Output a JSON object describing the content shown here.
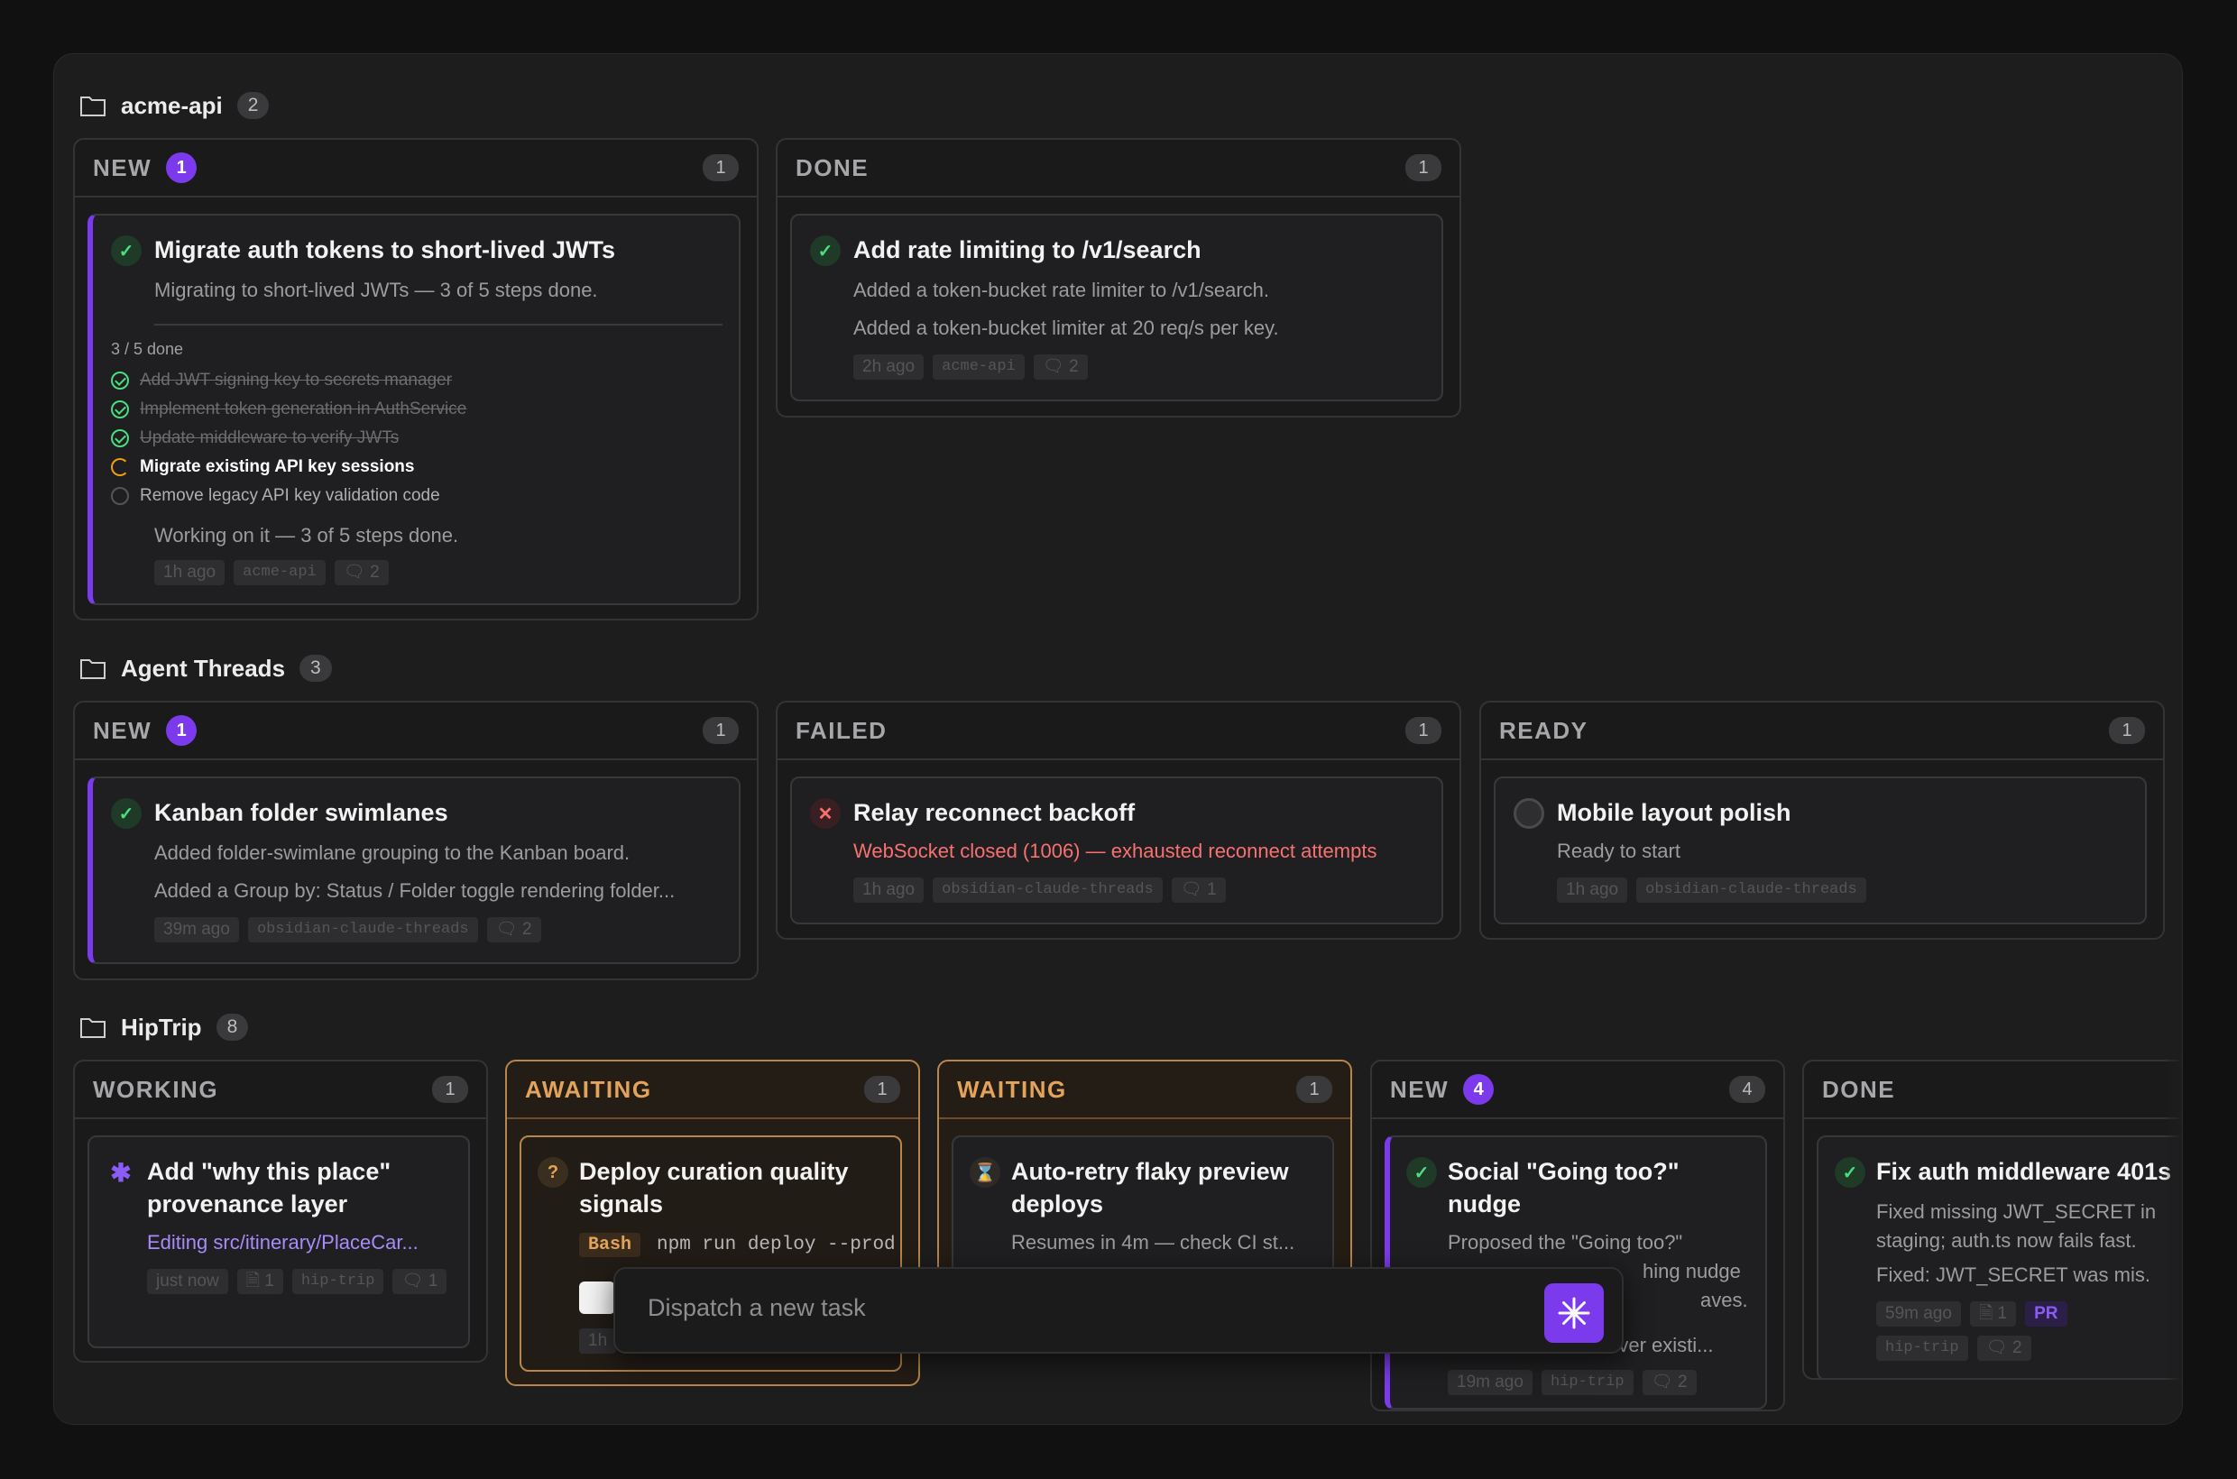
{
  "groups": [
    {
      "name": "acme-api",
      "count": "2",
      "columns": [
        {
          "title": "NEW",
          "badge": "1",
          "count": "1",
          "card": {
            "title": "Migrate auth tokens to short-lived JWTs",
            "desc1": "Migrating to short-lived JWTs — 3 of 5 steps done.",
            "progress": "3 / 5 done",
            "steps": [
              "Add JWT signing key to secrets manager",
              "Implement token generation in AuthService",
              "Update middleware to verify JWTs",
              "Migrate existing API key sessions",
              "Remove legacy API key validation code"
            ],
            "desc2": "Working on it — 3 of 5 steps done.",
            "tags": [
              "1h ago",
              "acme-api",
              "2"
            ]
          }
        },
        {
          "title": "DONE",
          "count": "1",
          "card": {
            "title": "Add rate limiting to /v1/search",
            "desc1": "Added a token-bucket rate limiter to /v1/search.",
            "desc2": "Added a token-bucket limiter at 20 req/s per key.",
            "tags": [
              "2h ago",
              "acme-api",
              "2"
            ]
          }
        }
      ]
    },
    {
      "name": "Agent Threads",
      "count": "3",
      "columns": [
        {
          "title": "NEW",
          "badge": "1",
          "count": "1",
          "card": {
            "title": "Kanban folder swimlanes",
            "desc1": "Added folder-swimlane grouping to the Kanban board.",
            "desc2": "Added a Group by: Status / Folder toggle rendering folder...",
            "tags": [
              "39m ago",
              "obsidian-claude-threads",
              "2"
            ]
          }
        },
        {
          "title": "FAILED",
          "count": "1",
          "card": {
            "title": "Relay reconnect backoff",
            "desc1": "WebSocket closed (1006) — exhausted reconnect attempts",
            "tags": [
              "1h ago",
              "obsidian-claude-threads",
              "1"
            ]
          }
        },
        {
          "title": "READY",
          "count": "1",
          "card": {
            "title": "Mobile layout polish",
            "desc1": "Ready to start",
            "tags": [
              "1h ago",
              "obsidian-claude-threads"
            ]
          }
        }
      ]
    },
    {
      "name": "HipTrip",
      "count": "8",
      "columns": [
        {
          "title": "WORKING",
          "count": "1",
          "card": {
            "title": "Add \"why this place\" provenance layer",
            "desc1": "Editing src/itinerary/PlaceCar...",
            "tags": [
              "just now",
              "1",
              "hip-trip",
              "1"
            ]
          }
        },
        {
          "title": "AWAITING",
          "count": "1",
          "card": {
            "title": "Deploy curation quality signals",
            "bash": "Bash",
            "cmd": "npm run deploy --prod",
            "tags": [
              "1h"
            ]
          }
        },
        {
          "title": "WAITING",
          "count": "1",
          "card": {
            "title": "Auto-retry flaky preview deploys",
            "desc1": "Resumes in 4m — check CI st..."
          }
        },
        {
          "title": "NEW",
          "badge": "4",
          "count": "4",
          "card": {
            "title": "Social \"Going too?\" nudge",
            "desc1": "Proposed the \"Going too?\"",
            "desc2": "hing nudge",
            "desc3": "aves.",
            "desc4": "x over existi...",
            "tags": [
              "19m ago",
              "hip-trip",
              "2"
            ]
          }
        },
        {
          "title": "DONE",
          "card": {
            "title": "Fix auth middleware 401s",
            "desc1": "Fixed missing JWT_SECRET in",
            "desc2": "staging; auth.ts now fails fast.",
            "desc3": "Fixed: JWT_SECRET was mis.",
            "tags": [
              "59m ago",
              "1",
              "PR",
              "hip-trip",
              "2"
            ]
          }
        }
      ]
    }
  ],
  "dispatch": {
    "placeholder": "Dispatch a new task"
  },
  "colors": {
    "accent": "#7c3aed",
    "warn": "#e3a35b",
    "success": "#4ade80",
    "error": "#f87171"
  }
}
